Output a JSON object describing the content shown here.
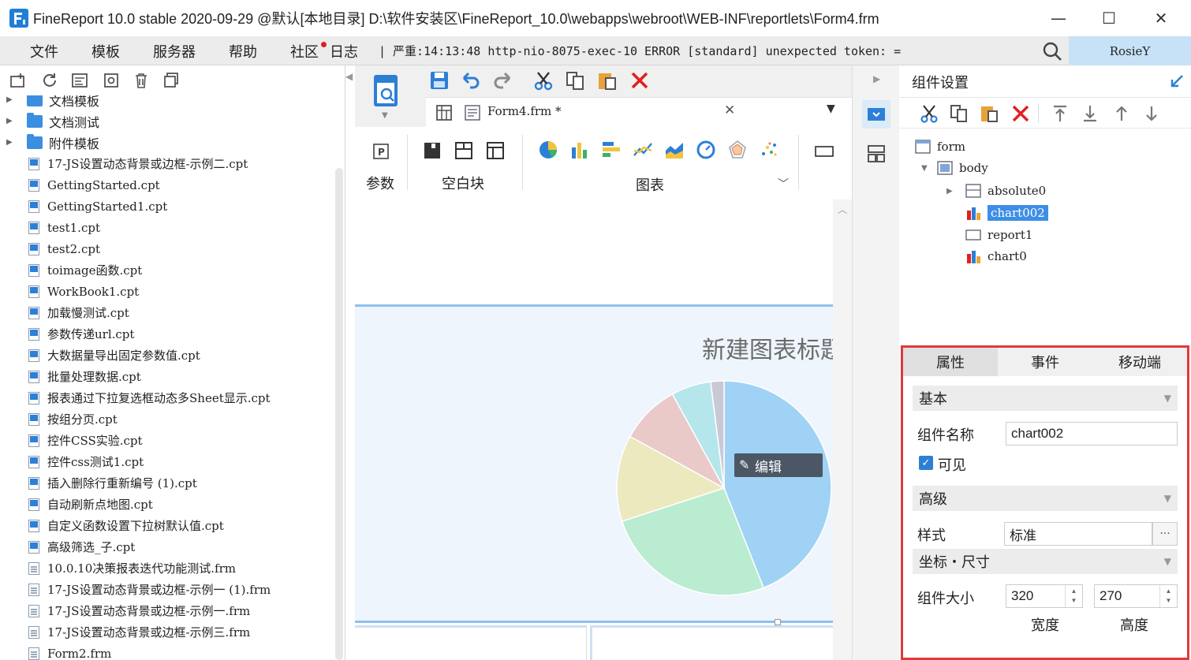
{
  "window": {
    "title": "FineReport 10.0 stable 2020-09-29 @默认[本地目录]     D:\\软件安装区\\FineReport_10.0\\webapps\\webroot\\WEB-INF\\reportlets\\Form4.frm",
    "minimize": "—",
    "maximize": "☐",
    "close": "✕"
  },
  "menu": {
    "items": [
      "文件",
      "模板",
      "服务器",
      "帮助",
      "社区"
    ],
    "log_label": "日志",
    "log_text": "| 严重:14:13:48 http-nio-8075-exec-10 ERROR [standard] unexpected token: =",
    "user": "RosieY"
  },
  "tree": {
    "folders": [
      "文档模板",
      "文档测试",
      "附件模板"
    ],
    "files": [
      {
        "name": "17-JS设置动态背景或边框-示例二.cpt",
        "type": "cpt"
      },
      {
        "name": "GettingStarted.cpt",
        "type": "cpt"
      },
      {
        "name": "GettingStarted1.cpt",
        "type": "cpt"
      },
      {
        "name": "test1.cpt",
        "type": "cpt"
      },
      {
        "name": "test2.cpt",
        "type": "cpt"
      },
      {
        "name": "toimage函数.cpt",
        "type": "cpt"
      },
      {
        "name": "WorkBook1.cpt",
        "type": "cpt"
      },
      {
        "name": "加载慢测试.cpt",
        "type": "cpt"
      },
      {
        "name": "参数传递url.cpt",
        "type": "cpt"
      },
      {
        "name": "大数据量导出固定参数值.cpt",
        "type": "cpt"
      },
      {
        "name": "批量处理数据.cpt",
        "type": "cpt"
      },
      {
        "name": "报表通过下拉复选框动态多Sheet显示.cpt",
        "type": "cpt"
      },
      {
        "name": "按组分页.cpt",
        "type": "cpt"
      },
      {
        "name": "控件CSS实验.cpt",
        "type": "cpt"
      },
      {
        "name": "控件css测试1.cpt",
        "type": "cpt"
      },
      {
        "name": "插入删除行重新编号 (1).cpt",
        "type": "cpt"
      },
      {
        "name": "自动刷新点地图.cpt",
        "type": "cpt"
      },
      {
        "name": "自定义函数设置下拉树默认值.cpt",
        "type": "cpt"
      },
      {
        "name": "高级筛选_子.cpt",
        "type": "cpt"
      },
      {
        "name": "10.0.10决策报表迭代功能测试.frm",
        "type": "frm"
      },
      {
        "name": "17-JS设置动态背景或边框-示例一 (1).frm",
        "type": "frm"
      },
      {
        "name": "17-JS设置动态背景或边框-示例一.frm",
        "type": "frm"
      },
      {
        "name": "17-JS设置动态背景或边框-示例三.frm",
        "type": "frm"
      },
      {
        "name": "Form2.frm",
        "type": "frm"
      }
    ]
  },
  "editor": {
    "tab_label": "Form4.frm *",
    "groups": {
      "params": "参数",
      "blank": "空白块",
      "chart": "图表"
    },
    "chart_title": "新建图表标题",
    "edit_badge": "编辑"
  },
  "pie_slices": [
    {
      "value": 0.44,
      "color": "#9fd2f5"
    },
    {
      "value": 0.26,
      "color": "#b9ecd0"
    },
    {
      "value": 0.13,
      "color": "#ede9bf"
    },
    {
      "value": 0.09,
      "color": "#eac9c9"
    },
    {
      "value": 0.06,
      "color": "#b5e6ec"
    },
    {
      "value": 0.02,
      "color": "#c9c9d6"
    }
  ],
  "component_panel": {
    "title": "组件设置",
    "nodes": [
      "form",
      "body",
      "absolute0",
      "chart002",
      "report1",
      "chart0"
    ],
    "selected": "chart002"
  },
  "props": {
    "tabs": [
      "属性",
      "事件",
      "移动端"
    ],
    "section_basic": "基本",
    "name_label": "组件名称",
    "name_value": "chart002",
    "visible_label": "可见",
    "section_advanced": "高级",
    "style_label": "样式",
    "style_value": "标准",
    "section_coords": "坐标・尺寸",
    "size_label": "组件大小",
    "width_value": "320",
    "height_value": "270",
    "width_label": "宽度",
    "height_label": "高度"
  }
}
